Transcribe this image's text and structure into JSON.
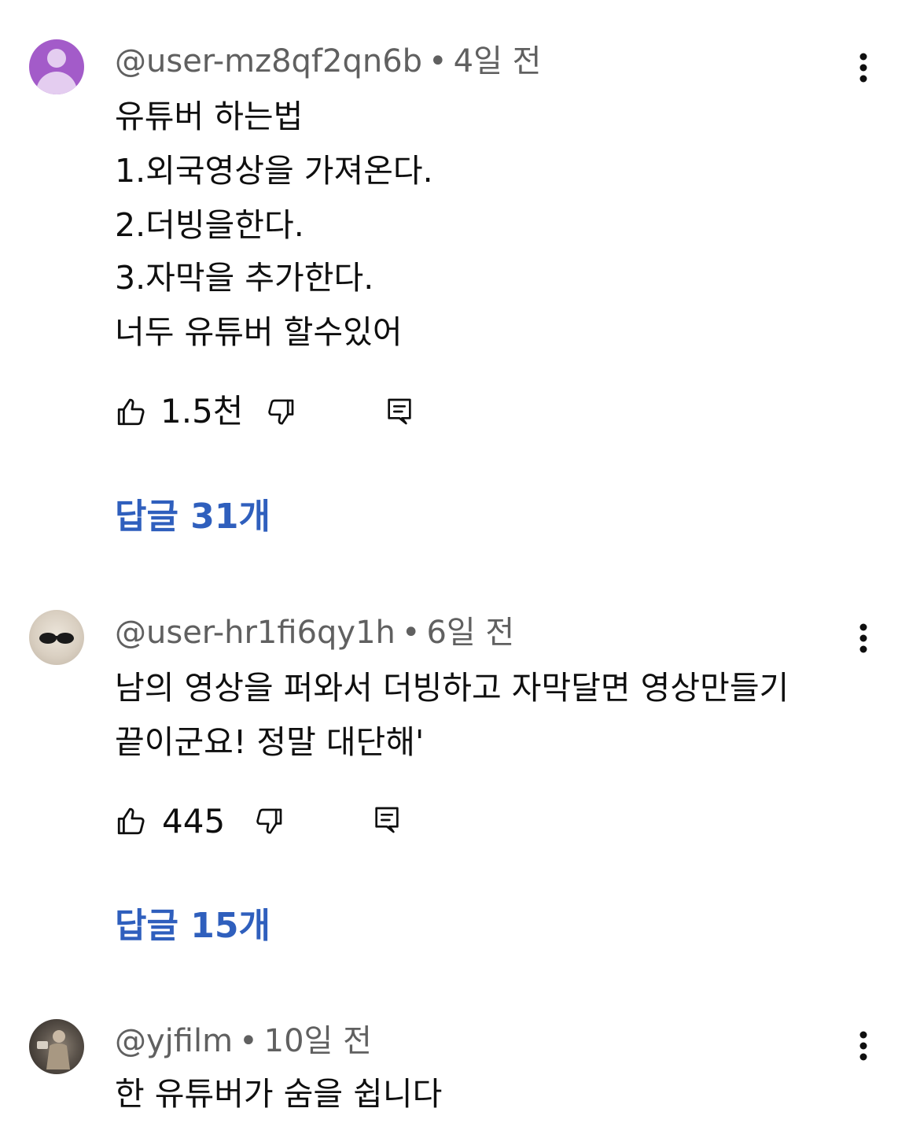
{
  "comments": [
    {
      "author": "@user-mz8qf2qn6b",
      "time": "4일 전",
      "lines": [
        "유튜버 하는법",
        "1.외국영상을 가져온다.",
        "2.더빙을한다.",
        "3.자막을 추가한다.",
        "너두 유튜버 할수있어"
      ],
      "likes": "1.5천",
      "replies": "답글 31개"
    },
    {
      "author": "@user-hr1fi6qy1h",
      "time": "6일 전",
      "lines": [
        "남의 영상을 퍼와서 더빙하고 자막달면 영상만들기",
        "끝이군요! 정말 대단해'"
      ],
      "likes": "445",
      "replies": "답글 15개"
    },
    {
      "author": "@yjfilm",
      "time": "10일 전",
      "lines": [
        "한 유튜버가 숨을 쉽니다"
      ]
    }
  ],
  "separator": "•",
  "icons": {
    "avatar_default": "default-person-icon",
    "like": "thumbs-up-icon",
    "dislike": "thumbs-down-icon",
    "reply": "comment-icon",
    "more": "more-vertical-icon"
  },
  "colors": {
    "reply_link": "#2f5fbd",
    "meta_text": "#606060",
    "avatar_purple": "#a35bc9"
  }
}
